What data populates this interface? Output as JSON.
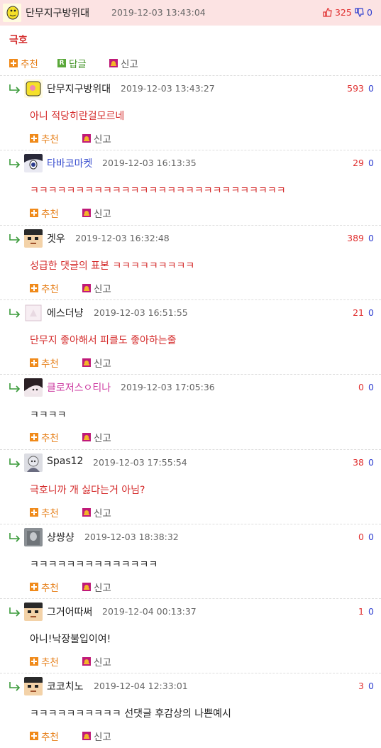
{
  "main": {
    "nick": "단무지구방위대",
    "date": "2019-12-03 13:43:04",
    "up": "325",
    "down": "0",
    "body": "극호",
    "recommend": "추천",
    "reply": "답글",
    "report": "신고",
    "reply_icon_letter": "R"
  },
  "replies": [
    {
      "nick": "단무지구방위대",
      "date": "2019-12-03 13:43:27",
      "up": "593",
      "down": "0",
      "body": "아니 적당히란걸모르네",
      "nick_color": "#222222",
      "body_color": "#d42a2a",
      "avatar": "yellow-face",
      "recommend": "추천",
      "report": "신고"
    },
    {
      "nick": "타바코마켓",
      "date": "2019-12-03 16:13:35",
      "up": "29",
      "down": "0",
      "body": "ㅋㅋㅋㅋㅋㅋㅋㅋㅋㅋㅋㅋㅋㅋㅋㅋㅋㅋㅋㅋㅋㅋㅋㅋㅋㅋㅋㅋ",
      "nick_color": "#3a4fcf",
      "body_color": "#d42a2a",
      "avatar": "anime-face",
      "recommend": "추천",
      "report": "신고"
    },
    {
      "nick": "겟우",
      "date": "2019-12-03 16:32:48",
      "up": "389",
      "down": "0",
      "body": "성급한 댓글의 표본 ㅋㅋㅋㅋㅋㅋㅋㅋㅋ",
      "nick_color": "#222222",
      "body_color": "#d42a2a",
      "avatar": "pixel-face",
      "recommend": "추천",
      "report": "신고"
    },
    {
      "nick": "에스더냥",
      "date": "2019-12-03 16:51:55",
      "up": "21",
      "down": "0",
      "body": "단무지 좋아해서 피클도 좋아하는줄",
      "nick_color": "#222222",
      "body_color": "#d42a2a",
      "avatar": "pale-face",
      "recommend": "추천",
      "report": "신고"
    },
    {
      "nick": "클로저스ㅇ티나",
      "date": "2019-12-03 17:05:36",
      "up": "0",
      "down": "0",
      "body": "ㅋㅋㅋㅋ",
      "nick_color": "#cc3aa0",
      "body_color": "#222222",
      "avatar": "dark-face",
      "recommend": "추천",
      "report": "신고"
    },
    {
      "nick": "Spas12",
      "date": "2019-12-03 17:55:54",
      "up": "38",
      "down": "0",
      "body": "극호니까 개 싫다는거 아님?",
      "nick_color": "#222222",
      "body_color": "#d42a2a",
      "avatar": "grey-face",
      "recommend": "추천",
      "report": "신고"
    },
    {
      "nick": "샹썅샹",
      "date": "2019-12-03 18:38:32",
      "up": "0",
      "down": "0",
      "body": "ㅋㅋㅋㅋㅋㅋㅋㅋㅋㅋㅋㅋㅋㅋ",
      "nick_color": "#222222",
      "body_color": "#222222",
      "avatar": "photo-face",
      "recommend": "추천",
      "report": "신고"
    },
    {
      "nick": "그거어따써",
      "date": "2019-12-04 00:13:37",
      "up": "1",
      "down": "0",
      "body": "아니!낙장불입이여!",
      "nick_color": "#222222",
      "body_color": "#222222",
      "avatar": "pixel-face",
      "recommend": "추천",
      "report": "신고"
    },
    {
      "nick": "코코치노",
      "date": "2019-12-04 12:33:01",
      "up": "3",
      "down": "0",
      "body": "ㅋㅋㅋㅋㅋㅋㅋㅋㅋㅋ 선댓글 후감상의 나쁜예시",
      "nick_color": "#222222",
      "body_color": "#222222",
      "avatar": "pixel-face",
      "recommend": "추천",
      "report": "신고"
    }
  ]
}
